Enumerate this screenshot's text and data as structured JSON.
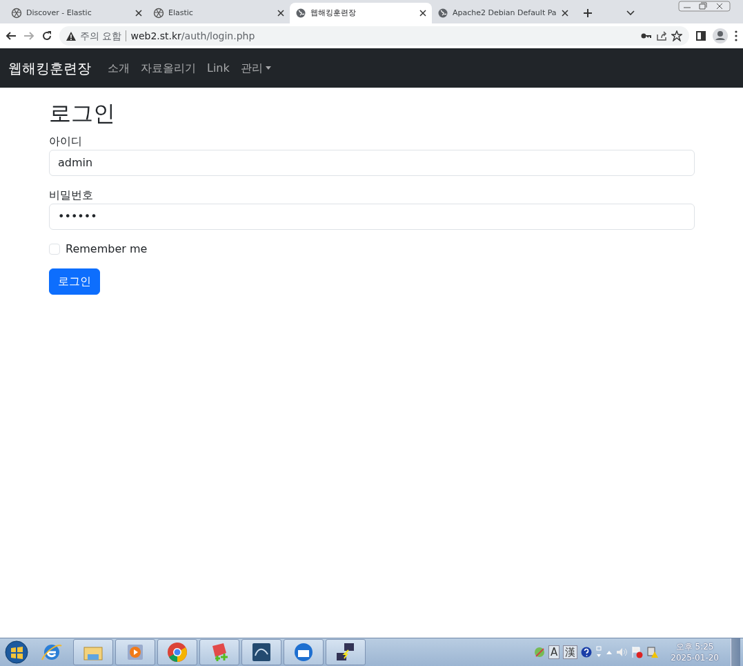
{
  "browser": {
    "tabs": [
      {
        "title": "Discover - Elastic",
        "kind": "elastic",
        "selected": false
      },
      {
        "title": "Elastic",
        "kind": "elastic",
        "selected": false
      },
      {
        "title": "웹해킹훈련장",
        "kind": "globe",
        "selected": true
      },
      {
        "title": "Apache2 Debian Default Pa",
        "kind": "globe",
        "selected": false
      }
    ],
    "address": {
      "warning": "주의 요함",
      "host": "web2.st.kr",
      "path": "/auth/login.php"
    }
  },
  "navbar": {
    "brand": "웹해킹훈련장",
    "items": [
      {
        "label": "소개",
        "kind": "link"
      },
      {
        "label": "자료올리기",
        "kind": "link"
      },
      {
        "label": "Link",
        "kind": "link"
      },
      {
        "label": "관리",
        "kind": "dropdown"
      }
    ]
  },
  "page": {
    "heading": "로그인",
    "fields": [
      {
        "label": "아이디",
        "value": "admin"
      },
      {
        "label": "비밀번호",
        "value": "••••••"
      }
    ],
    "remember": {
      "label": "Remember me",
      "checked": false
    },
    "submit": "로그인"
  },
  "taskbar": {
    "apps": [
      {
        "kind": "explorer"
      },
      {
        "kind": "media"
      },
      {
        "kind": "chrome"
      },
      {
        "kind": "editor"
      },
      {
        "kind": "db"
      },
      {
        "kind": "mail"
      },
      {
        "kind": "network"
      }
    ],
    "ime": [
      "A",
      "漢"
    ],
    "time": "오후 5:25",
    "date": "2025-01-20"
  }
}
